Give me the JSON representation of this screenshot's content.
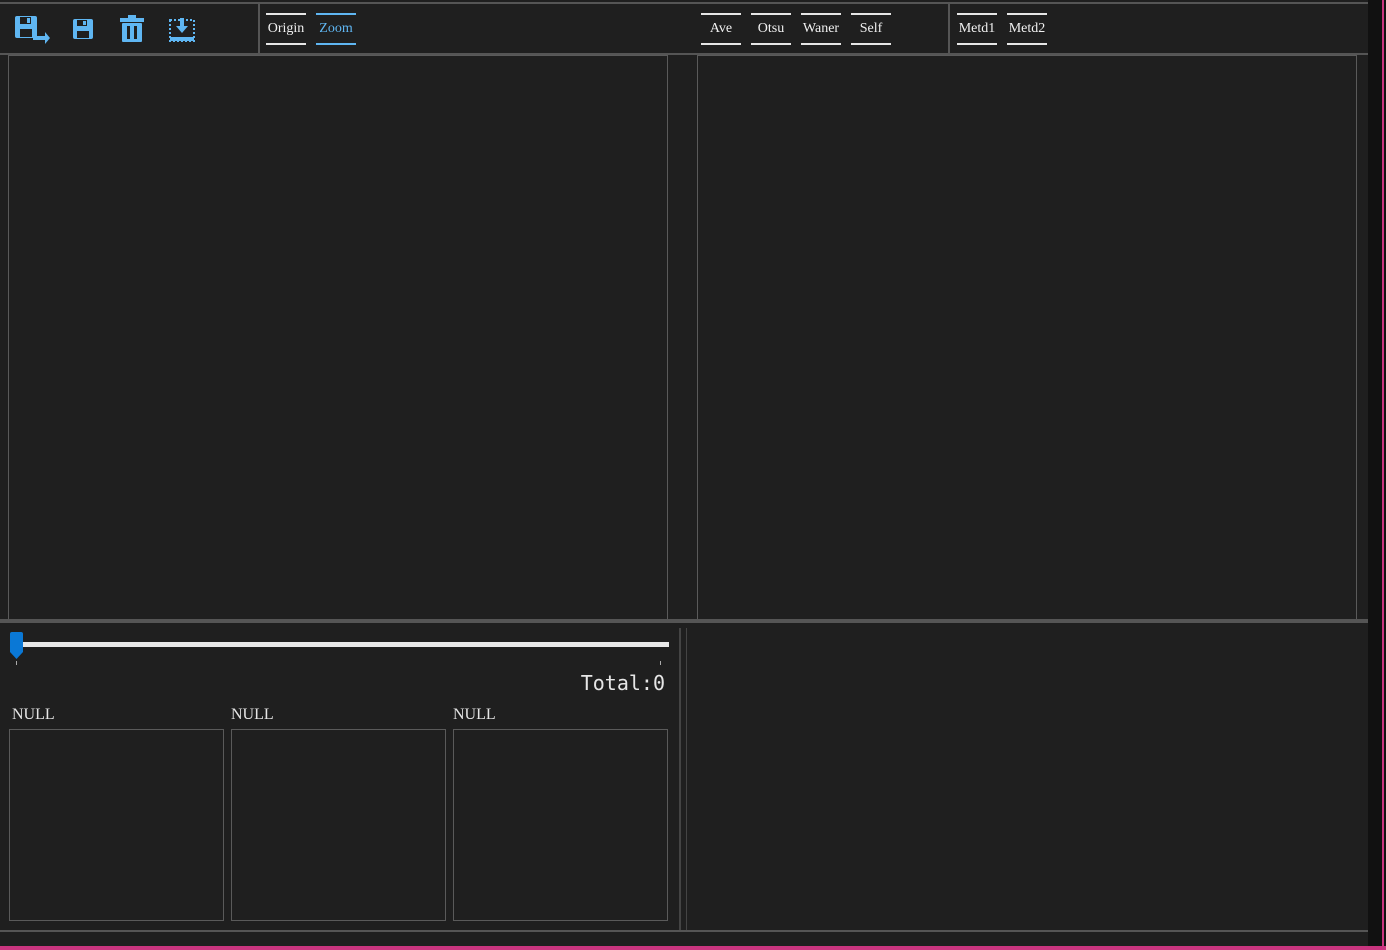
{
  "toolbar": {
    "icons": [
      {
        "name": "save-as-icon"
      },
      {
        "name": "save-icon"
      },
      {
        "name": "delete-icon"
      },
      {
        "name": "import-icon"
      }
    ],
    "view_tabs": [
      {
        "label": "Origin",
        "active": false
      },
      {
        "label": "Zoom",
        "active": true
      }
    ],
    "threshold_tabs": [
      {
        "label": "Ave"
      },
      {
        "label": "Otsu"
      },
      {
        "label": "Waner"
      },
      {
        "label": "Self"
      }
    ],
    "method_tabs": [
      {
        "label": "Metd1"
      },
      {
        "label": "Metd2"
      }
    ]
  },
  "slider": {
    "value": 0
  },
  "total_label": "Total:0",
  "thumbnails": [
    {
      "label": "NULL"
    },
    {
      "label": "NULL"
    },
    {
      "label": "NULL"
    }
  ],
  "colors": {
    "background": "#1f1f1f",
    "accent": "#5fb6f2",
    "slider_thumb": "#0a78d6",
    "border": "#5a5a5a",
    "window_frame": "#c9357f"
  }
}
